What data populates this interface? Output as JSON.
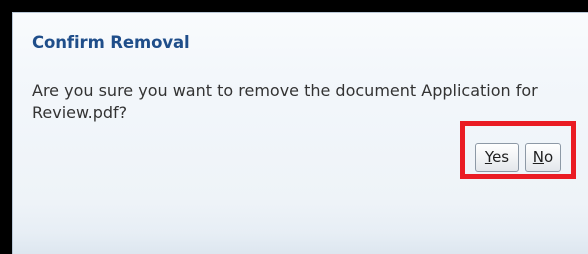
{
  "dialog": {
    "title": "Confirm Removal",
    "message": "Are you sure you want to remove the document Application for Review.pdf?",
    "buttons": {
      "yes": {
        "mnemonic": "Y",
        "rest": "es"
      },
      "no": {
        "mnemonic": "N",
        "rest": "o"
      }
    }
  },
  "colors": {
    "title": "#1f4e8a",
    "highlight": "#ea1c24",
    "background": "#f3f7fb"
  }
}
